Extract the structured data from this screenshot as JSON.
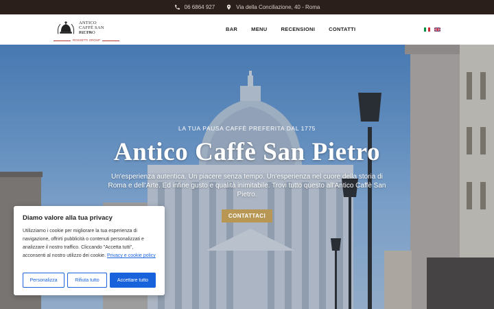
{
  "topbar": {
    "phone": "06 6864 927",
    "address": "Via della Conciliazione, 40 - Roma",
    "phone_icon": "phone-icon",
    "location_icon": "location-pin-icon"
  },
  "logo": {
    "line1": "ANTICO",
    "line2": "CAFFÈ SAN PIETRO",
    "line3": "DAL 1775",
    "group": "ROSSETTI GROUP"
  },
  "nav": {
    "items": [
      "BAR",
      "MENU",
      "RECENSIONI",
      "CONTATTI"
    ]
  },
  "languages": [
    "it",
    "en"
  ],
  "hero": {
    "tagline": "LA TUA PAUSA CAFFÈ PREFERITA DAL 1775",
    "title": "Antico Caffè San Pietro",
    "subtitle": "Un'esperienza autentica. Un piacere senza tempo. Un'esperienza nel cuore della storia di Roma e dell'Arte. Ed infine gusto e qualità inimitabile. Trovi tutto questo all'Antico Caffè San Pietro.",
    "cta": "CONTATTACI"
  },
  "cookie": {
    "title": "Diamo valore alla tua privacy",
    "text": "Utilizziamo i cookie per migliorare la tua esperienza di navigazione, offrirti pubblicità o contenuti personalizzati e analizzare il nostro traffico. Cliccando \"Accetta tutti\", acconsenti al nostro utilizzo dei cookie.",
    "link": "Privacy e cookie policy",
    "customize": "Personalizza",
    "reject": "Rifiuta tutto",
    "accept": "Accettare tutto"
  },
  "colors": {
    "topbar_bg": "#2b1f1c",
    "cta_gold": "#b89654",
    "cookie_blue": "#1863dc",
    "logo_red": "#b63a3a"
  }
}
